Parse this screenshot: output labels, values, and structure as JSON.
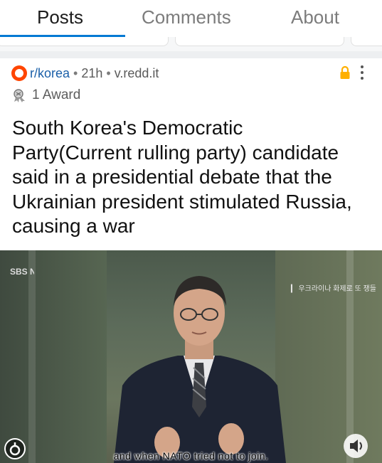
{
  "tabs": [
    {
      "label": "Posts",
      "active": true
    },
    {
      "label": "Comments",
      "active": false
    },
    {
      "label": "About",
      "active": false
    }
  ],
  "post": {
    "subreddit": "r/korea",
    "age": "21h",
    "domain": "v.redd.it",
    "award_count": "1 Award",
    "title": "South Korea's Democratic Party(Current rulling party) candidate said in a presidential debate that the Ukrainian president stimulated Russia, causing a war",
    "icons": [
      "subreddit-avatar",
      "lock-icon",
      "more-options-icon",
      "award-icon"
    ]
  },
  "video": {
    "channel_logo": "SBS NEWS",
    "corner_caption": "▎ 우크라이나 화제로 또 쟁들",
    "subtitle": "and when NATO tried not to join.",
    "controls": [
      "live-indicator-icon",
      "volume-icon"
    ]
  },
  "colors": {
    "accent": "#0079d3",
    "lock": "#ffb000",
    "link": "#1a5fa8"
  }
}
